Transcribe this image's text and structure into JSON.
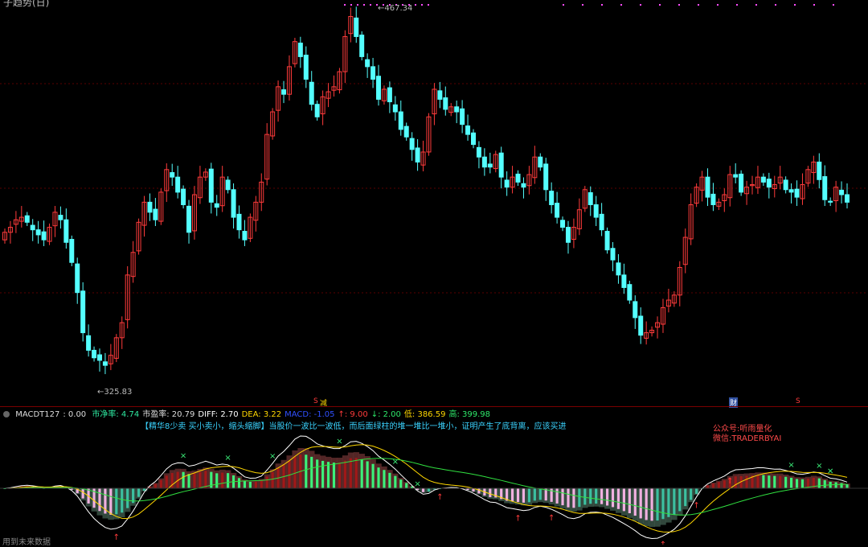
{
  "title": "子趋势(日)",
  "price_labels": {
    "high": "467.34",
    "low": "325.83"
  },
  "indicator": {
    "name": "MACDT127",
    "value": ": 0.00",
    "items": [
      {
        "label": "市净率:",
        "value": "4.74",
        "color": "#2ee8a0"
      },
      {
        "label": "市盈率:",
        "value": "20.79",
        "color": "#dddddd"
      },
      {
        "label": "DIFF:",
        "value": "2.70",
        "color": "#ffffff"
      },
      {
        "label": "DEA:",
        "value": "3.22",
        "color": "#ffd700"
      },
      {
        "label": "MACD:",
        "value": "-1.05",
        "color": "#3050ff"
      },
      {
        "label": "↑:",
        "value": "9.00",
        "color": "#ff3b3b"
      },
      {
        "label": "↓:",
        "value": "2.00",
        "color": "#2ee86a"
      },
      {
        "label": "低:",
        "value": "386.59",
        "color": "#ffd700"
      },
      {
        "label": "高:",
        "value": "399.98",
        "color": "#2ee86a"
      }
    ]
  },
  "commentary": "【精华8少卖 买小卖小，缩头缩脚】当股价一波比一波低，而后面绿柱的堆一堆比一堆小，证明产生了底背离，应该买进",
  "watermark": {
    "line1": "公众号:听雨量化",
    "line2": "微信:TRADERBYAI"
  },
  "markers": {
    "jian": "减",
    "cai": "财",
    "s": "S"
  },
  "footer": "用到未来数据",
  "chart_data": {
    "type": "candlestick",
    "price_range": [
      320,
      470
    ],
    "high_label": 467.34,
    "low_label": 325.83,
    "up_color": "#ff3b3b",
    "down_color": "#54ffff",
    "close_series": [
      380,
      382,
      385,
      386,
      384,
      381,
      379,
      377,
      382,
      388,
      385,
      376,
      368,
      356,
      340,
      333,
      330,
      329,
      327,
      331,
      338,
      344,
      363,
      372,
      384,
      392,
      388,
      385,
      396,
      405,
      402,
      396,
      391,
      380,
      395,
      402,
      404,
      392,
      390,
      402,
      397,
      386,
      381,
      377,
      386,
      392,
      400,
      419,
      428,
      438,
      435,
      446,
      456,
      450,
      441,
      431,
      426,
      434,
      436,
      438,
      444,
      458,
      466,
      458,
      450,
      446,
      441,
      433,
      437,
      432,
      428,
      421,
      418,
      413,
      408,
      412,
      426,
      437,
      433,
      429,
      430,
      428,
      423,
      419,
      415,
      410,
      406,
      406,
      411,
      402,
      398,
      402,
      400,
      398,
      403,
      410,
      406,
      397,
      391,
      386,
      382,
      376,
      382,
      389,
      397,
      391,
      386,
      381,
      373,
      369,
      363,
      358,
      353,
      346,
      339,
      340,
      341,
      344,
      350,
      353,
      355,
      366,
      378,
      391,
      398,
      402,
      394,
      391,
      392,
      395,
      403,
      402,
      396,
      398,
      399,
      402,
      400,
      398,
      399,
      402,
      397,
      396,
      394,
      399,
      405,
      408,
      401,
      393,
      392,
      398,
      395,
      392
    ],
    "indicator_type": "macd"
  }
}
